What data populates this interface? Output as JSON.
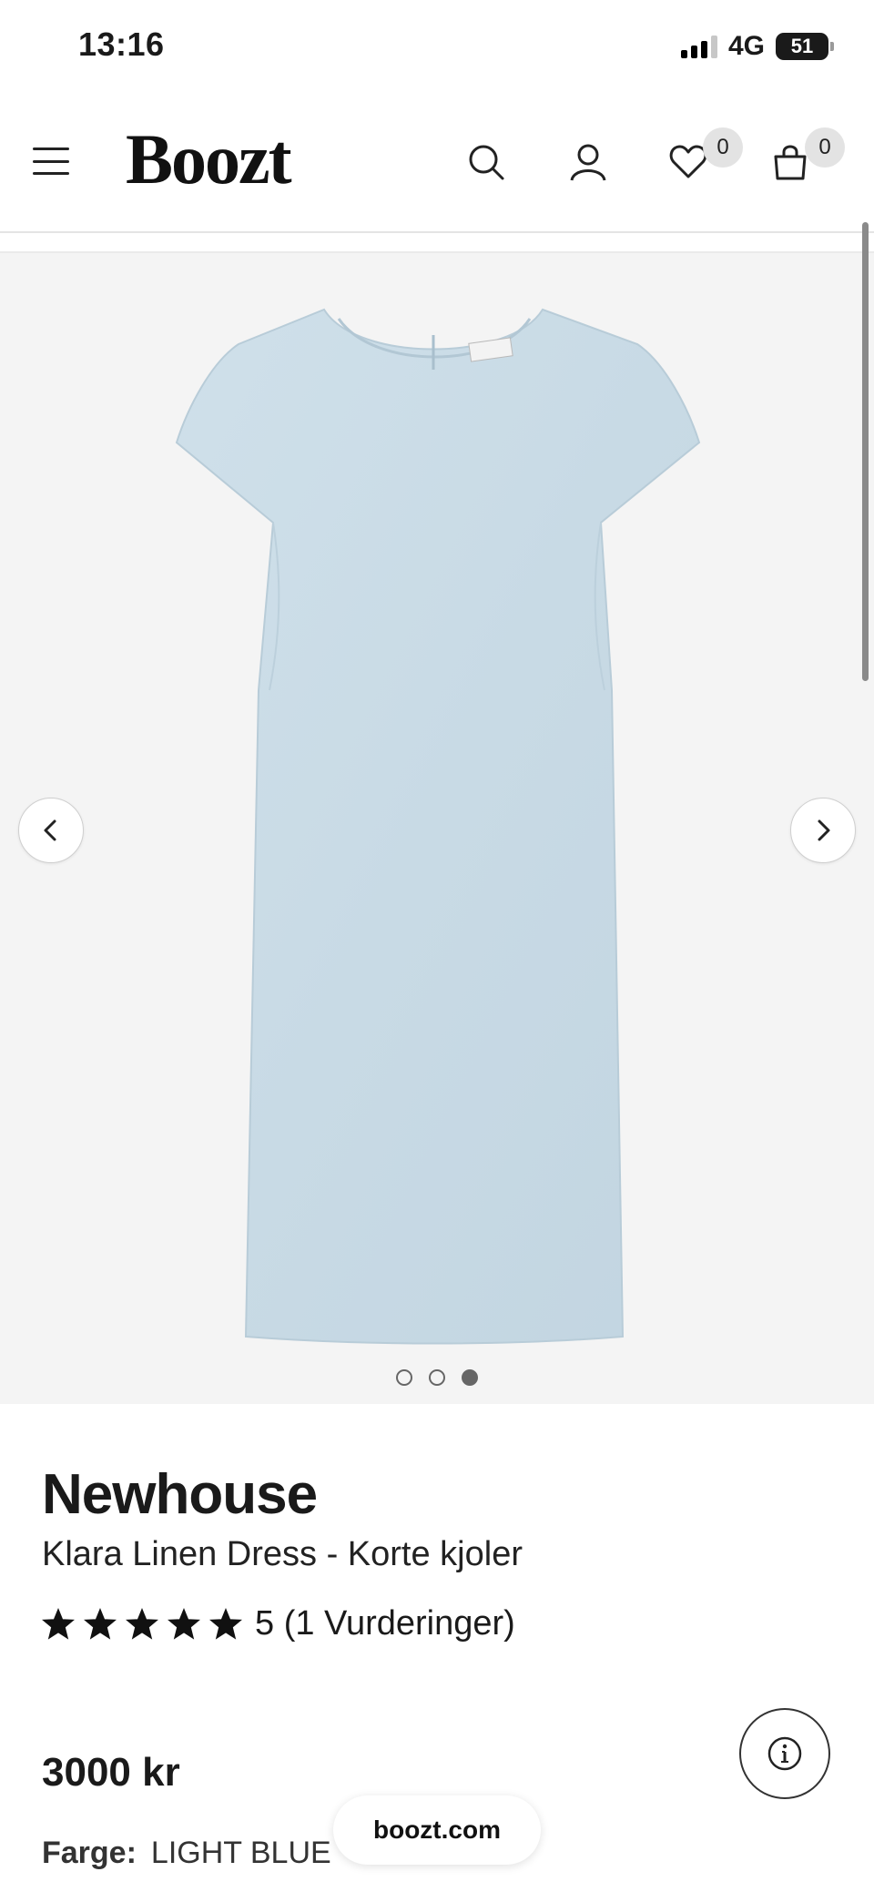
{
  "status_bar": {
    "time": "13:16",
    "network": "4G",
    "battery": "51"
  },
  "header": {
    "logo": "Boozt",
    "wishlist_count": "0",
    "cart_count": "0",
    "icons": [
      "menu-icon",
      "search-icon",
      "account-icon",
      "heart-icon",
      "shopping-bag-icon"
    ]
  },
  "gallery": {
    "image_alt": "Light blue linen short-sleeve shift dress",
    "dress_color": "#c9dbe6",
    "slide_count": 3,
    "active_slide": 3
  },
  "product": {
    "brand": "Newhouse",
    "name": "Klara Linen Dress - Korte kjoler",
    "rating_stars": 5,
    "rating_text": "5 (1 Vurderinger)",
    "price": "3000 kr",
    "color_label": "Farge:",
    "color_value": "LIGHT BLUE"
  },
  "browser": {
    "url": "boozt.com"
  }
}
